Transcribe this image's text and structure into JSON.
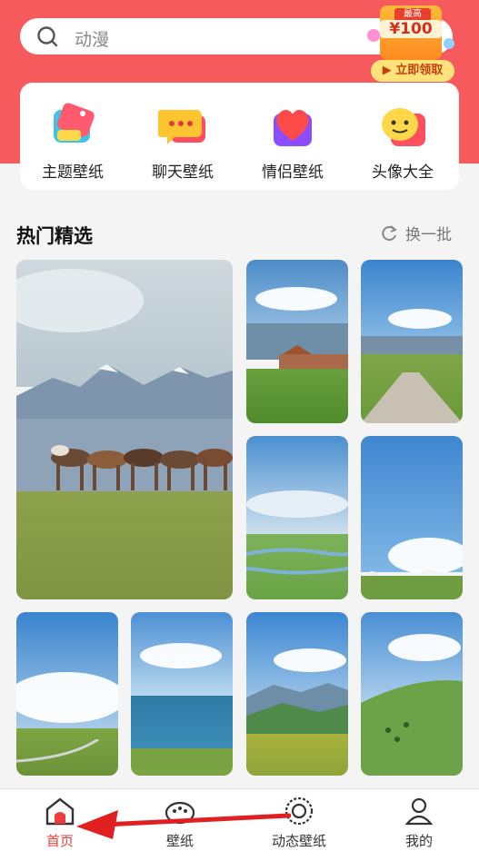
{
  "search": {
    "placeholder_text": "动漫",
    "icon": "search-icon"
  },
  "promo": {
    "tag": "最高",
    "amount": "¥100",
    "button": "立即领取"
  },
  "categories": [
    {
      "label": "主题壁纸",
      "icon": "theme-tag-icon"
    },
    {
      "label": "聊天壁纸",
      "icon": "chat-bubble-icon"
    },
    {
      "label": "情侣壁纸",
      "icon": "heart-icon"
    },
    {
      "label": "头像大全",
      "icon": "smiley-avatar-icon"
    }
  ],
  "section": {
    "title": "热门精选",
    "refresh_label": "换一批",
    "refresh_icon": "refresh-icon"
  },
  "wallpapers": [
    {
      "scene": "horses-on-grassland-mountains"
    },
    {
      "scene": "village-house-green-field"
    },
    {
      "scene": "road-through-grassland"
    },
    {
      "scene": "winding-river-plain"
    },
    {
      "scene": "yurts-under-clouds"
    },
    {
      "scene": "grassland-path-clouds"
    },
    {
      "scene": "blue-lake-shore"
    },
    {
      "scene": "mountain-meadow-valley"
    },
    {
      "scene": "green-hill-sky"
    }
  ],
  "tabs": [
    {
      "label": "首页",
      "icon": "home-icon",
      "active": true
    },
    {
      "label": "壁纸",
      "icon": "palette-icon",
      "active": false
    },
    {
      "label": "动态壁纸",
      "icon": "live-wallpaper-icon",
      "active": false
    },
    {
      "label": "我的",
      "icon": "profile-icon",
      "active": false
    }
  ],
  "colors": {
    "brand": "#f75a5c",
    "active_tab": "#ef3b3b",
    "arrow": "#e02020"
  }
}
